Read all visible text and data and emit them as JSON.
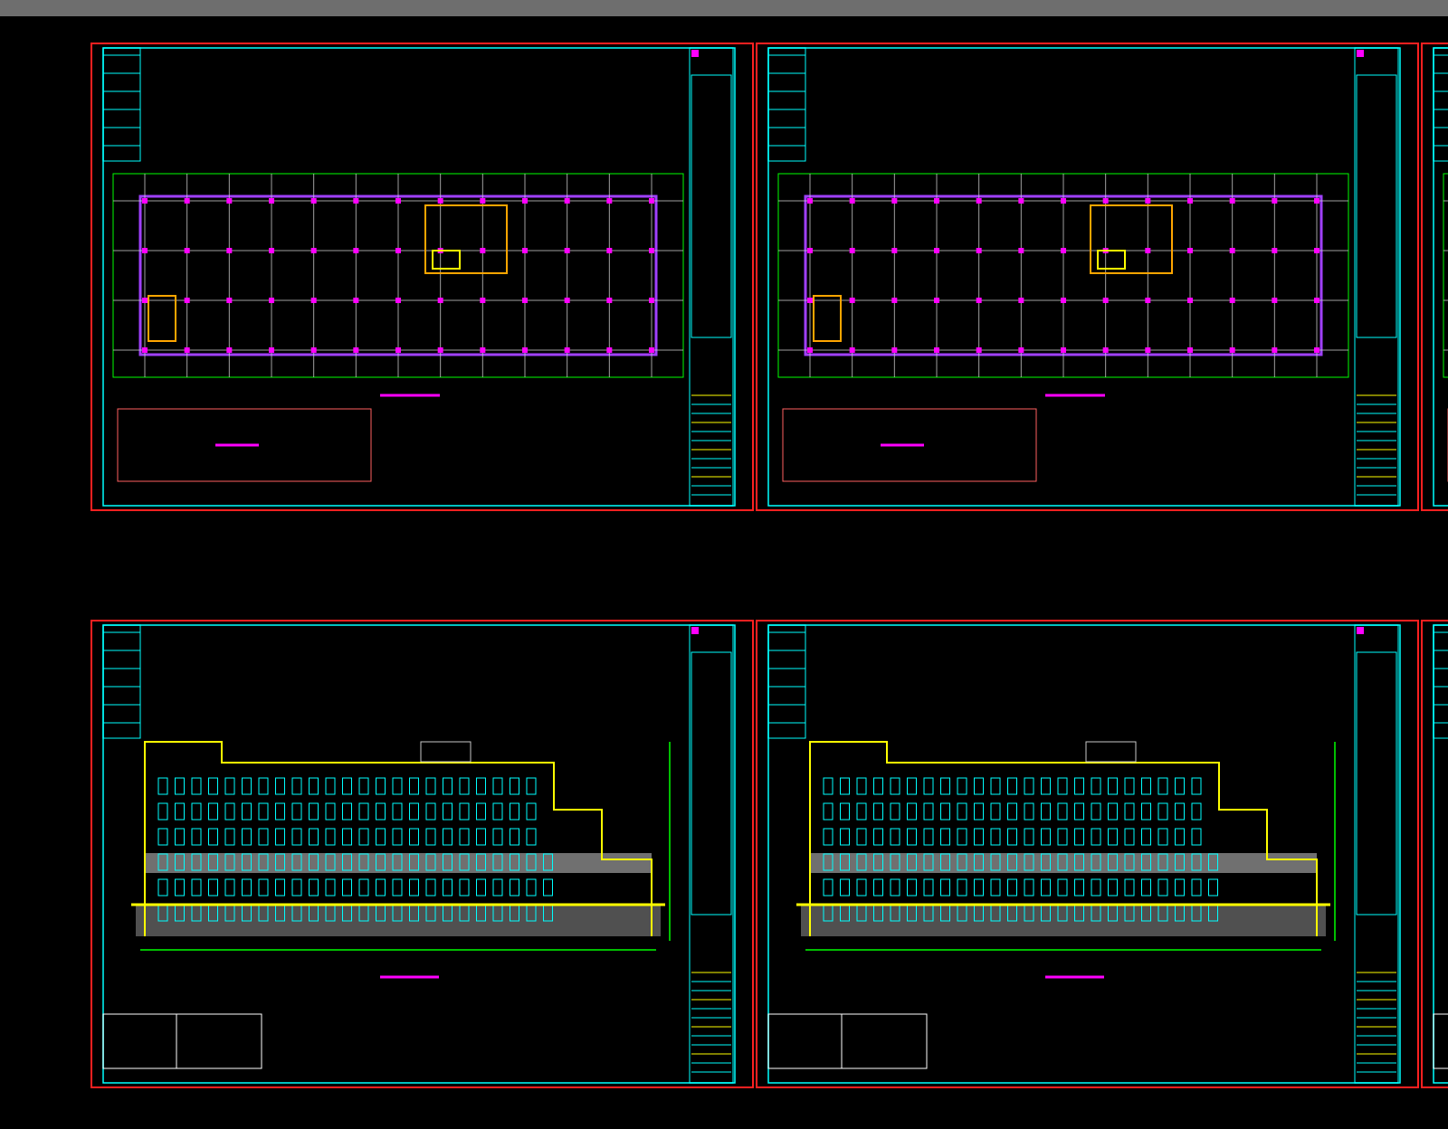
{
  "sheets": [
    {
      "kind": "plan"
    },
    {
      "kind": "plan"
    },
    {
      "kind": "plan"
    },
    {
      "kind": "elevation"
    },
    {
      "kind": "elevation"
    },
    {
      "kind": "elevation"
    }
  ]
}
